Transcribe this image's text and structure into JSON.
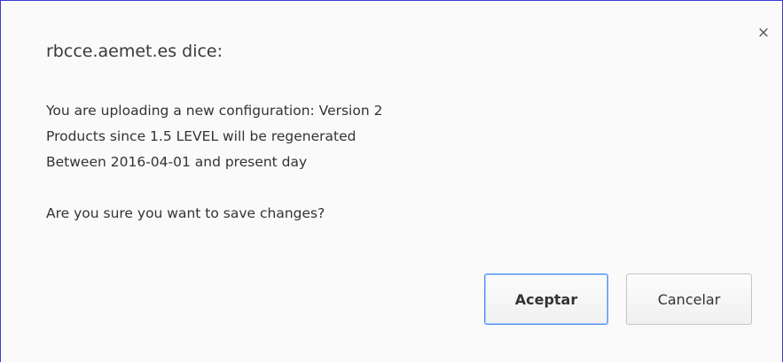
{
  "dialog": {
    "title": "rbcce.aemet.es dice:",
    "close_glyph": "×",
    "message_lines": [
      "You are uploading a new configuration: Version 2",
      "Products since 1.5 LEVEL will be regenerated",
      "Between 2016-04-01 and present day"
    ],
    "question": "Are you sure you want to save changes?",
    "ok_label": "Aceptar",
    "cancel_label": "Cancelar",
    "accent_color": "#4d90fe"
  }
}
